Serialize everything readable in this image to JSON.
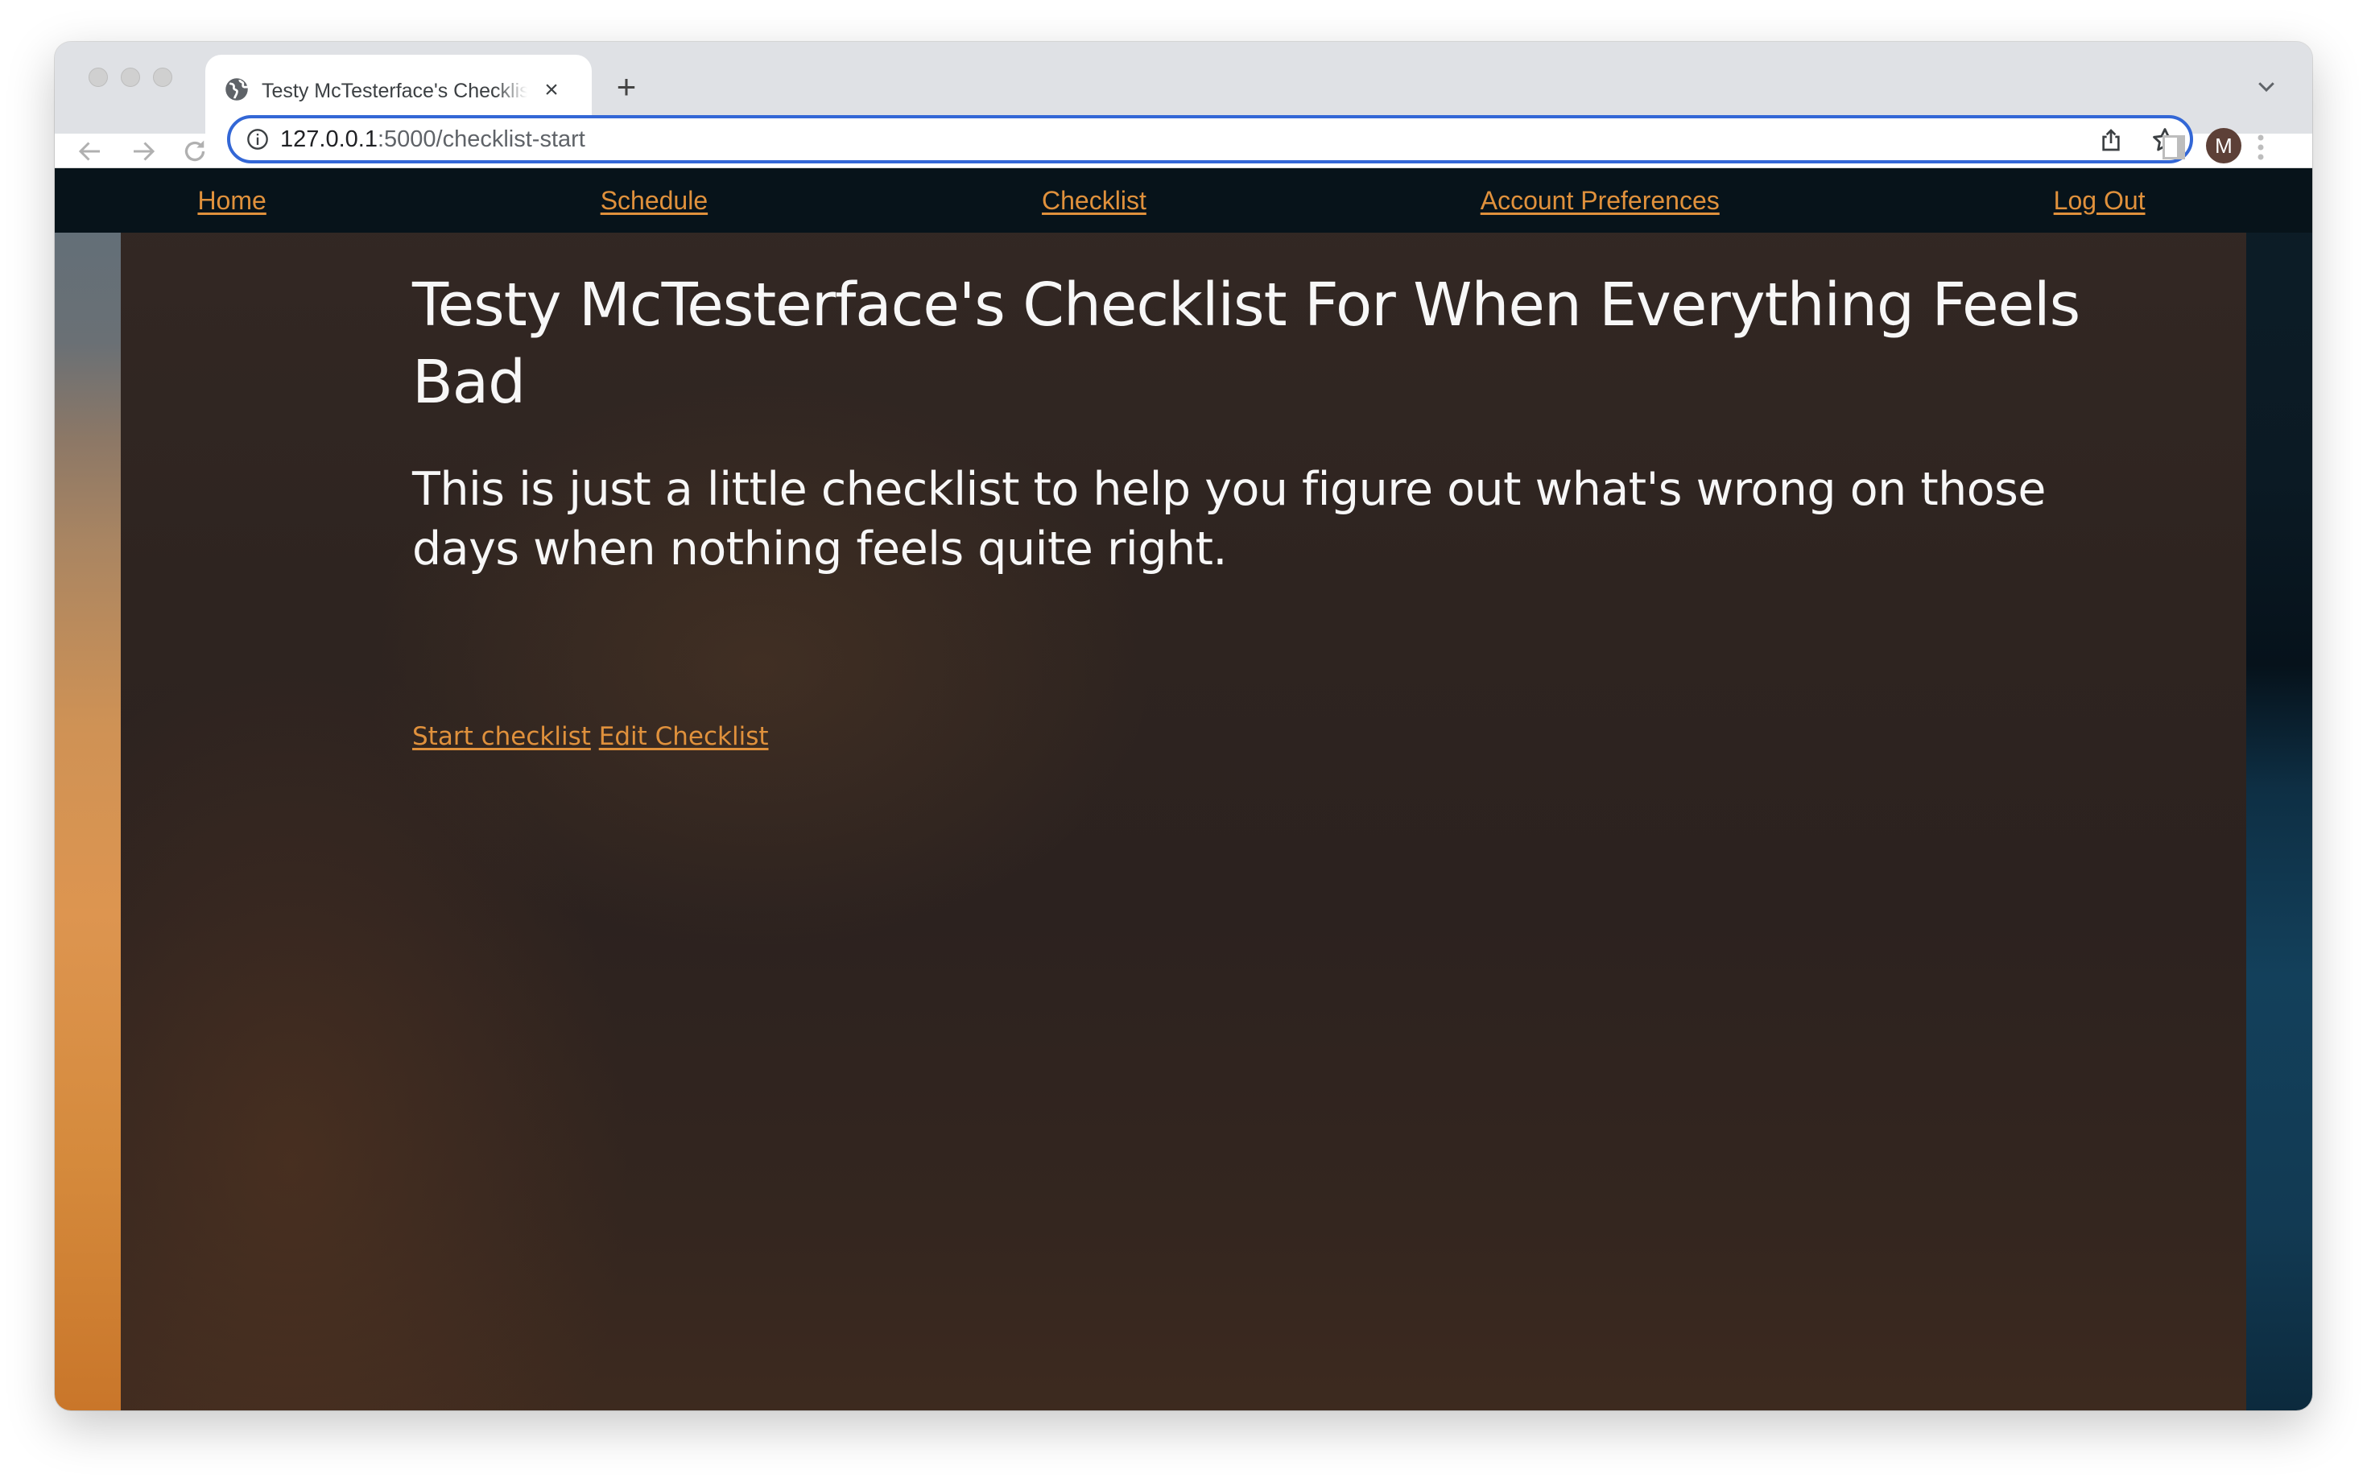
{
  "browser": {
    "tab": {
      "title": "Testy McTesterface's Checklist For When Everything Feels Bad",
      "favicon": "globe-icon",
      "close_glyph": "×"
    },
    "new_tab_glyph": "+",
    "address_bar": {
      "host": "127.0.0.1",
      "path": ":5000/checklist-start",
      "security_icon": "info-icon"
    },
    "toolbar_icons": [
      "back-arrow-icon",
      "forward-arrow-icon",
      "reload-icon",
      "share-icon",
      "bookmark-star-icon",
      "side-panel-icon",
      "kebab-menu-icon"
    ],
    "profile_initial": "M",
    "colors": {
      "omnibox_focus": "#3367d6",
      "avatar": "#5d4037"
    }
  },
  "nav": {
    "items": [
      {
        "label": "Home"
      },
      {
        "label": "Schedule"
      },
      {
        "label": "Checklist"
      },
      {
        "label": "Account Preferences"
      },
      {
        "label": "Log Out"
      }
    ],
    "colors": {
      "background": "#07131a",
      "link": "#e0913c"
    }
  },
  "main": {
    "title": "Testy McTesterface's Checklist For When Everything Feels Bad",
    "subtitle": "This is just a little checklist to help you figure out what's wrong on those days when nothing feels quite right.",
    "actions": [
      {
        "label": "Start checklist"
      },
      {
        "label": "Edit Checklist"
      }
    ]
  }
}
